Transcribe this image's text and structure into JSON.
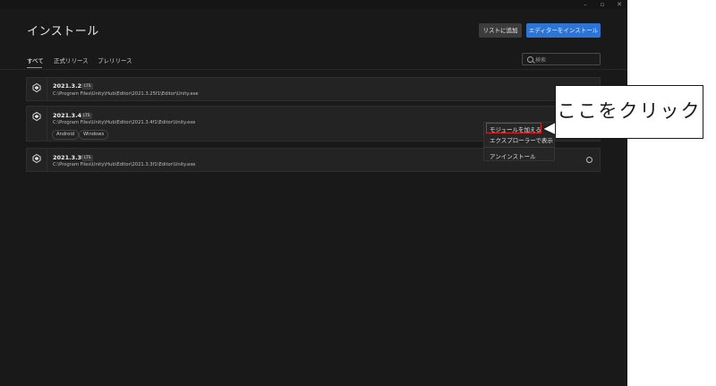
{
  "window": {
    "controls": [
      {
        "name": "minimize-button",
        "glyph": "–"
      },
      {
        "name": "maximize-button",
        "glyph": "▫"
      },
      {
        "name": "close-button",
        "glyph": "✕"
      }
    ]
  },
  "header": {
    "title": "インストール",
    "add_to_list": "リストに追加",
    "install_editor": "エディターをインストール"
  },
  "tabs": [
    {
      "label": "すべて",
      "active": true
    },
    {
      "label": "正式リリース",
      "active": false
    },
    {
      "label": "プレリリース",
      "active": false
    }
  ],
  "search": {
    "placeholder": "検索"
  },
  "installs": [
    {
      "version": "2021.3.25f1",
      "badge": "LTS",
      "path": "C:\\Program Files\\Unity\\Hub\\Editor\\2021.3.25f1\\Editor\\Unity.exe",
      "modules": []
    },
    {
      "version": "2021.3.4f1",
      "badge": "LTS",
      "path": "C:\\Program Files\\Unity\\Hub\\Editor\\2021.3.4f1\\Editor\\Unity.exe",
      "modules": [
        "Android",
        "Windows"
      ]
    },
    {
      "version": "2021.3.3f1",
      "badge": "LTS",
      "path": "C:\\Program Files\\Unity\\Hub\\Editor\\2021.3.3f1\\Editor\\Unity.exe",
      "modules": []
    }
  ],
  "context_menu": {
    "add_modules": "モジュールを加える",
    "show_in_explorer": "エクスプローラーで表示",
    "uninstall": "アンインストール"
  },
  "annotation": {
    "callout_text": "ここをクリック",
    "highlight_color": "#e02020"
  },
  "colors": {
    "accent": "#2e74d5",
    "background": "#191919"
  }
}
